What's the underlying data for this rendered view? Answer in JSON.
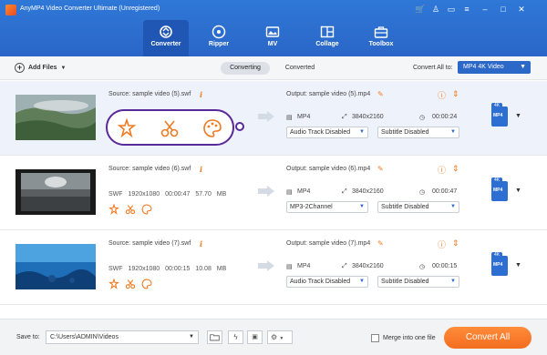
{
  "app": {
    "title": "AnyMP4 Video Converter Ultimate (Unregistered)"
  },
  "tabs": [
    {
      "label": "Converter",
      "icon": "converter-icon",
      "active": true
    },
    {
      "label": "Ripper",
      "icon": "ripper-icon",
      "active": false
    },
    {
      "label": "MV",
      "icon": "mv-icon",
      "active": false
    },
    {
      "label": "Collage",
      "icon": "collage-icon",
      "active": false
    },
    {
      "label": "Toolbox",
      "icon": "toolbox-icon",
      "active": false
    }
  ],
  "toolbar": {
    "add_files": "Add Files",
    "converting": "Converting",
    "converted": "Converted",
    "convert_all_to_label": "Convert All to:",
    "convert_all_format": "MP4 4K Video"
  },
  "files": [
    {
      "source": "Source: sample video (5).swf",
      "output": "Output: sample video (5).mp4",
      "out_format": "MP4",
      "out_resolution": "3840x2160",
      "out_duration": "00:00:24",
      "audio_track": "Audio Track Disabled",
      "subtitle": "Subtitle Disabled",
      "badge_top": "4K",
      "badge_format": "MP4"
    },
    {
      "source": "Source: sample video (6).swf",
      "src_format": "SWF",
      "src_resolution": "1920x1080",
      "src_duration": "00:00:47",
      "src_size": "57.70 MB",
      "output": "Output: sample video (6).mp4",
      "out_format": "MP4",
      "out_resolution": "3840x2160",
      "out_duration": "00:00:47",
      "audio_track": "MP3-2Channel",
      "subtitle": "Subtitle Disabled",
      "badge_top": "4K",
      "badge_format": "MP4"
    },
    {
      "source": "Source: sample video (7).swf",
      "src_format": "SWF",
      "src_resolution": "1920x1080",
      "src_duration": "00:00:15",
      "src_size": "10.08 MB",
      "output": "Output: sample video (7).mp4",
      "out_format": "MP4",
      "out_resolution": "3840x2160",
      "out_duration": "00:00:15",
      "audio_track": "Audio Track Disabled",
      "subtitle": "Subtitle Disabled",
      "badge_top": "4K",
      "badge_format": "MP4"
    }
  ],
  "footer": {
    "save_to_label": "Save to:",
    "save_path": "C:\\Users\\ADMIN\\Videos",
    "merge_label": "Merge into one file",
    "convert_all_button": "Convert All"
  },
  "colors": {
    "header_blue": "#2a6ad0",
    "accent_orange": "#f07a22",
    "highlight_purple": "#5a2a9a"
  }
}
